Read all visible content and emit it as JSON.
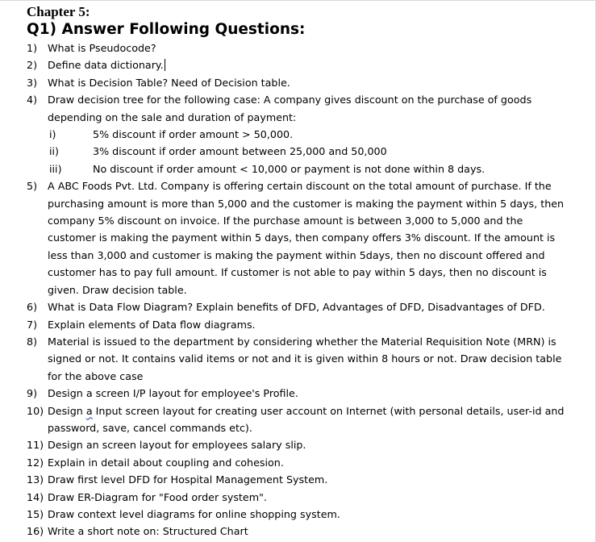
{
  "chapter_title": "Chapter 5:",
  "question_heading": "Q1) Answer Following Questions:",
  "questions": [
    {
      "num": "1)",
      "lines": [
        "What is Pseudocode?"
      ]
    },
    {
      "num": "2)",
      "lines": [
        "Define data dictionary."
      ]
    },
    {
      "num": "3)",
      "lines": [
        "What is Decision Table? Need of Decision table."
      ]
    },
    {
      "num": "4)",
      "lines": [
        "Draw decision tree for the following case: A company gives discount on the purchase of goods",
        "depending on the sale and duration of payment:"
      ],
      "subitems": [
        {
          "num": "i)",
          "text": "5% discount if order amount > 50,000."
        },
        {
          "num": "ii)",
          "text": "3% discount if order amount between 25,000 and 50,000"
        },
        {
          "num": "iii)",
          "text": "No discount if order amount < 10,000 or payment is not done within 8 days."
        }
      ]
    },
    {
      "num": "5)",
      "lines": [
        "A ABC Foods Pvt. Ltd. Company is offering certain discount on the total amount of purchase. If the",
        "purchasing amount is more than 5,000 and the customer is making the payment within 5 days, then",
        "company 5% discount on invoice. If the purchase amount is between 3,000 to 5,000 and the",
        "customer is making the payment within 5 days, then company offers 3% discount. If the amount is",
        "less than 3,000 and customer is making the payment within 5days, then no discount offered and",
        "customer has to pay full amount. If customer is not able to pay within 5 days, then no discount is",
        "given. Draw decision table."
      ]
    },
    {
      "num": "6)",
      "lines": [
        "What is Data Flow Diagram? Explain benefits of DFD, Advantages of DFD, Disadvantages of DFD."
      ]
    },
    {
      "num": "7)",
      "lines": [
        "Explain elements of Data flow diagrams."
      ]
    },
    {
      "num": "8)",
      "lines": [
        "Material is issued to the department by considering whether the Material Requisition Note (MRN) is",
        "signed or not. It contains valid items or not and it is given within 8 hours or not. Draw decision table",
        "for the above case"
      ]
    },
    {
      "num": "9)",
      "lines": [
        "Design a screen I/P layout for employee's Profile."
      ]
    },
    {
      "num": "10)",
      "lines": [
        "Design a Input screen layout for creating user account on Internet (with personal details, user-id and",
        "password, save, cancel commands etc)."
      ]
    },
    {
      "num": "11)",
      "lines": [
        "Design an screen layout for employees salary slip."
      ]
    },
    {
      "num": "12)",
      "lines": [
        "Explain in detail about coupling and cohesion."
      ]
    },
    {
      "num": "13)",
      "lines": [
        "Draw first level DFD for Hospital Management System."
      ]
    },
    {
      "num": "14)",
      "lines": [
        "Draw ER-Diagram for \"Food order system\"."
      ]
    },
    {
      "num": "15)",
      "lines": [
        "Draw context level diagrams for online shopping system."
      ]
    },
    {
      "num": "16)",
      "lines": [
        "Write a short note on: Structured Chart"
      ]
    }
  ]
}
